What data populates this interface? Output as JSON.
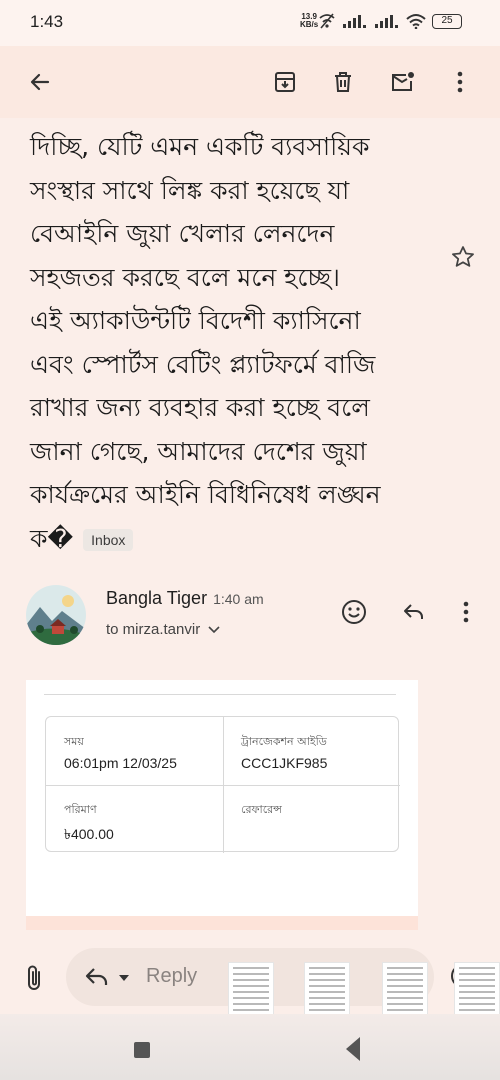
{
  "status_bar": {
    "time": "1:43",
    "net_speed_value": "13.9",
    "net_speed_unit": "KB/s",
    "battery": "25"
  },
  "toolbar": {
    "icons": [
      "back-arrow-icon",
      "archive-icon",
      "delete-icon",
      "mark-unread-icon",
      "more-vert-icon"
    ]
  },
  "message": {
    "body_lines": [
      "দিচ্ছি, যেটি এমন একটি ব্যবসায়িক",
      "সংস্থার সাথে লিঙ্ক করা হয়েছে যা",
      "বেআইনি জুয়া খেলার লেনদেন",
      "সহজতর করছে বলে মনে হচ্ছে।",
      "এই অ্যাকাউন্টটি বিদেশী ক্যাসিনো",
      "এবং স্পোর্টস বেটিং প্ল্যাটফর্মে বাজি",
      "রাখার জন্য ব্যবহার করা হচ্ছে বলে",
      "জানা গেছে, আমাদের দেশের জুয়া",
      "কার্যক্রমের আইনি বিধিনিষেধ লঙ্ঘন"
    ],
    "last_line": "ক�",
    "label_chip": "Inbox"
  },
  "sender": {
    "name": "Bangla Tiger",
    "time": "1:40 am",
    "to": "to mirza.tanvir"
  },
  "transaction": {
    "time_label": "সময়",
    "time_value": "06:01pm 12/03/25",
    "txid_label": "ট্রানজেকশন আইডি",
    "txid_value": "CCC1JKF985",
    "amount_label": "পরিমাণ",
    "amount_value": "৳400.00",
    "reference_label": "রেফারেন্স",
    "reference_value": ""
  },
  "reply_bar": {
    "reply_label": "Reply"
  },
  "colors": {
    "background": "#fbeee9",
    "toolbar": "#fbe9e1",
    "card": "#ffffff"
  }
}
